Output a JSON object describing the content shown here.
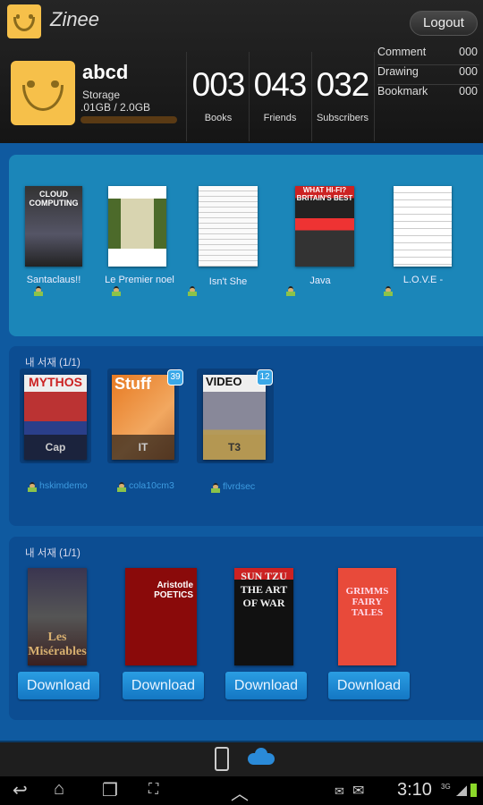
{
  "app": {
    "title": "Zinee",
    "logout_label": "Logout"
  },
  "profile": {
    "username": "abcd",
    "storage_label": "Storage",
    "storage_value": ".01GB / 2.0GB",
    "storage_used_fraction": 0.005,
    "stats": [
      {
        "value": "003",
        "label": "Books"
      },
      {
        "value": "043",
        "label": "Friends"
      },
      {
        "value": "032",
        "label": "Subscribers"
      }
    ],
    "side_stats": [
      {
        "label": "Comment",
        "value": "000"
      },
      {
        "label": "Drawing",
        "value": "000"
      },
      {
        "label": "Bookmark",
        "value": "000"
      }
    ]
  },
  "featured": {
    "items": [
      {
        "title": "Santaclaus!!",
        "cover_text": "CLOUD COMPUTING"
      },
      {
        "title": "Le Premier noel",
        "cover_text": ""
      },
      {
        "title": "Isn't She",
        "cover_text": ""
      },
      {
        "title": "Java",
        "cover_text": "WHAT HI-FI? BRITAIN'S BEST"
      },
      {
        "title": "L.O.V.E -",
        "cover_text": ""
      }
    ]
  },
  "shelf": {
    "title": "내 서재 (1/1)",
    "items": [
      {
        "label": "Cap",
        "cover_text": "MYTHOS",
        "owner": "hskimdemo",
        "badge": ""
      },
      {
        "label": "IT",
        "cover_text": "Stuff",
        "owner": "cola10cm3",
        "badge": "39"
      },
      {
        "label": "T3",
        "cover_text": "VIDEO",
        "owner": "flvrdsec",
        "badge": "12"
      }
    ]
  },
  "store": {
    "title": "내 서재 (1/1)",
    "download_label": "Download",
    "items": [
      {
        "cover_text": "Les Misérables"
      },
      {
        "cover_text": "Aristotle POETICS"
      },
      {
        "cover_text": "SUN TZU THE ART OF WAR"
      },
      {
        "cover_text": "GRIMMS FAIRY TALES"
      }
    ]
  },
  "status": {
    "time": "3:10",
    "network": "3G"
  }
}
